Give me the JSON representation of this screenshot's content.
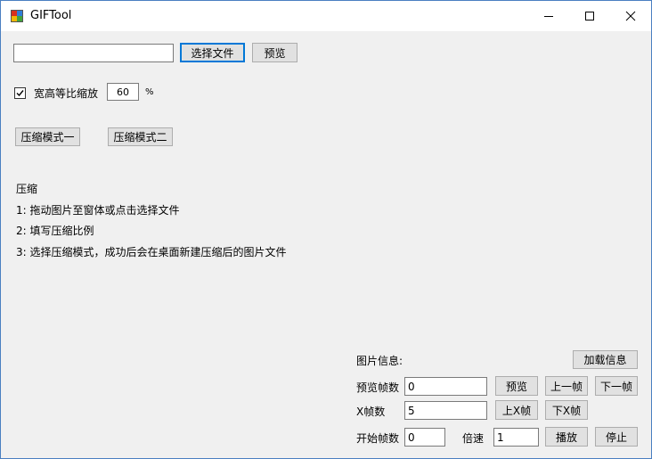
{
  "window": {
    "title": "GIFTool"
  },
  "file": {
    "path_value": "",
    "choose_button": "选择文件",
    "preview_button": "预览"
  },
  "scale": {
    "checkbox_label": "宽高等比缩放",
    "checked": true,
    "value": "60",
    "unit": "%"
  },
  "modes": {
    "mode1": "压缩模式一",
    "mode2": "压缩模式二"
  },
  "instructions": {
    "heading": "压缩",
    "steps": [
      "1: 拖动图片至窗体或点击选择文件",
      "2: 填写压缩比例",
      "3: 选择压缩模式，成功后会在桌面新建压缩后的图片文件"
    ]
  },
  "image_info": {
    "label": "图片信息:",
    "load_button": "加载信息",
    "preview_frames_label": "预览帧数",
    "preview_frames_value": "0",
    "preview_button": "预览",
    "prev_frame_button": "上一帧",
    "next_frame_button": "下一帧",
    "x_frames_label": "X帧数",
    "x_frames_value": "5",
    "up_x_button": "上X帧",
    "down_x_button": "下X帧",
    "start_frame_label": "开始帧数",
    "start_frame_value": "0",
    "speed_label": "倍速",
    "speed_value": "1",
    "play_button": "播放",
    "stop_button": "停止"
  }
}
